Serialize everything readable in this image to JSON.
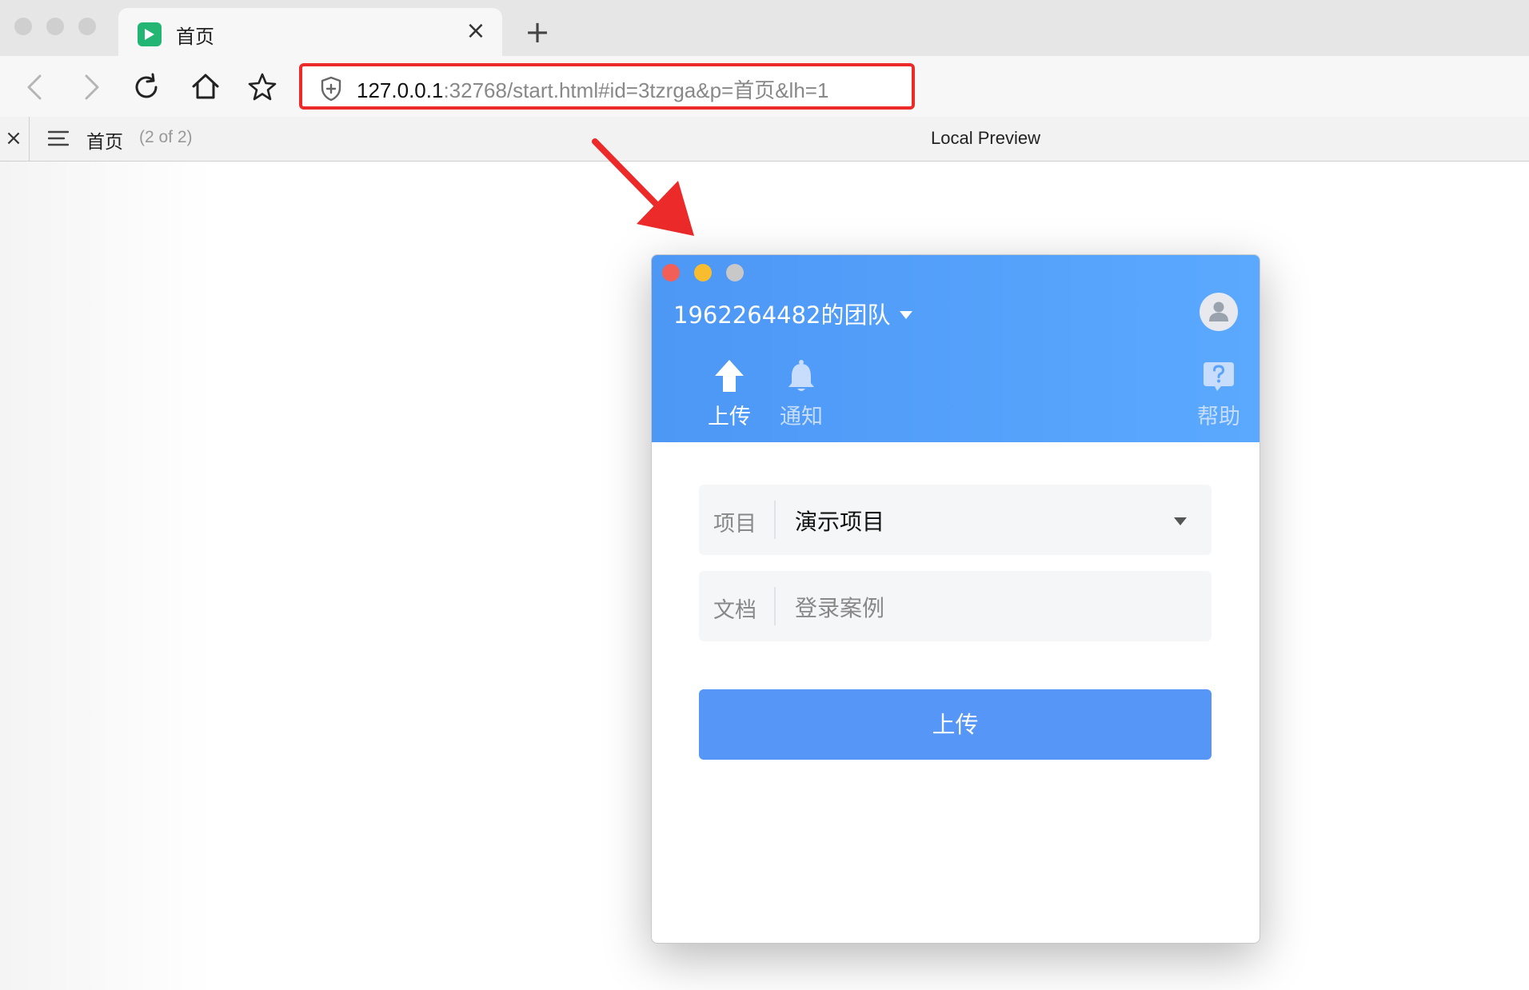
{
  "browser": {
    "tab": {
      "title": "首页",
      "close_glyph": "×"
    },
    "new_tab_glyph": "+",
    "toolbar_icons": [
      "back-icon",
      "forward-icon",
      "reload-icon",
      "home-icon",
      "bookmark-star-icon"
    ],
    "url": {
      "host": "127.0.0.1",
      "rest": ":32768/start.html#id=3tzrga&p=首页&lh=1"
    },
    "infobar": {
      "close_glyph": "×",
      "page_name": "首页",
      "page_count": "(2 of 2)",
      "center_label": "Local Preview"
    }
  },
  "annotation": {
    "arrow_color": "#ec2a2a"
  },
  "app": {
    "team_name": "1962264482的团队",
    "nav": [
      {
        "label": "上传",
        "icon": "upload-arrow-icon",
        "active": true
      },
      {
        "label": "通知",
        "icon": "bell-icon",
        "active": false
      },
      {
        "label": "帮助",
        "icon": "help-icon",
        "active": false
      }
    ],
    "form": {
      "project": {
        "label": "项目",
        "value": "演示项目"
      },
      "document": {
        "label": "文档",
        "placeholder": "登录案例"
      }
    },
    "submit_label": "上传",
    "colors": {
      "header": "#4d97f5",
      "button": "#5596f7",
      "close": "#f25f58",
      "minimize": "#f7bd2e",
      "zoom": "#c8c8c8"
    }
  }
}
